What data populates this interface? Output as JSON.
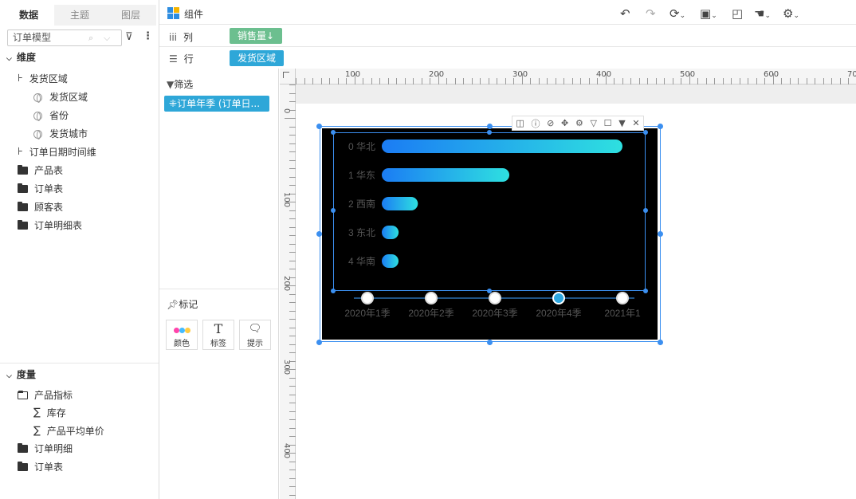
{
  "left": {
    "tabs": [
      "数据",
      "主题",
      "图层"
    ],
    "model": "订单模型",
    "dimension_title": "维度",
    "dimensions": [
      {
        "label": "发货区域",
        "icon": "hierarchy-icon",
        "level": 0
      },
      {
        "label": "发货区域",
        "icon": "globe-icon",
        "level": 1
      },
      {
        "label": "省份",
        "icon": "globe-icon",
        "level": 1
      },
      {
        "label": "发货城市",
        "icon": "globe-icon",
        "level": 1
      },
      {
        "label": "订单日期时间维",
        "icon": "hierarchy-icon",
        "level": 0
      },
      {
        "label": "产品表",
        "icon": "folder-icon",
        "level": 0
      },
      {
        "label": "订单表",
        "icon": "folder-icon",
        "level": 0
      },
      {
        "label": "顾客表",
        "icon": "folder-icon",
        "level": 0
      },
      {
        "label": "订单明细表",
        "icon": "folder-icon",
        "level": 0
      }
    ],
    "measure_title": "度量",
    "measures": [
      {
        "label": "产品指标",
        "icon": "folder-open-icon",
        "level": 0
      },
      {
        "label": "库存",
        "icon": "sigma-icon",
        "level": 1
      },
      {
        "label": "产品平均单价",
        "icon": "sigma-icon",
        "level": 1
      },
      {
        "label": "订单明细",
        "icon": "folder-icon",
        "level": 0
      },
      {
        "label": "订单表",
        "icon": "folder-icon",
        "level": 0
      }
    ]
  },
  "toolbar": {
    "components_label": "组件",
    "columns_label": "列",
    "rows_label": "行",
    "column_pill": "销售量↓",
    "row_pill": "发货区域",
    "column_pill_color": "#6cbf8f",
    "row_pill_color": "#2ea7d8"
  },
  "mid": {
    "filter_title": "筛选",
    "filter_pill": "订单年季 (订单日...",
    "mark_title": "标记",
    "mark_buttons": [
      {
        "label": "颜色",
        "icon": "color-icon"
      },
      {
        "label": "标签",
        "icon": "text-icon"
      },
      {
        "label": "提示",
        "icon": "tooltip-icon"
      }
    ]
  },
  "ruler": {
    "h_labels": [
      "100",
      "200",
      "300",
      "400",
      "500",
      "600",
      "70"
    ],
    "v_labels": [
      "0",
      "100",
      "200",
      "300",
      "400"
    ]
  },
  "chart_data": {
    "type": "bar",
    "orientation": "horizontal",
    "background": "#000000",
    "bar_gradient": [
      "#1b7cf4",
      "#2ee0e0"
    ],
    "categories": [
      "0 华北",
      "1 华东",
      "2 西南",
      "3 东北",
      "4 华南"
    ],
    "values": [
      100,
      53,
      15,
      7,
      6
    ],
    "timeline": [
      "2020年1季",
      "2020年2季",
      "2020年3季",
      "2020年4季",
      "2021年1"
    ],
    "timeline_active": 3
  }
}
